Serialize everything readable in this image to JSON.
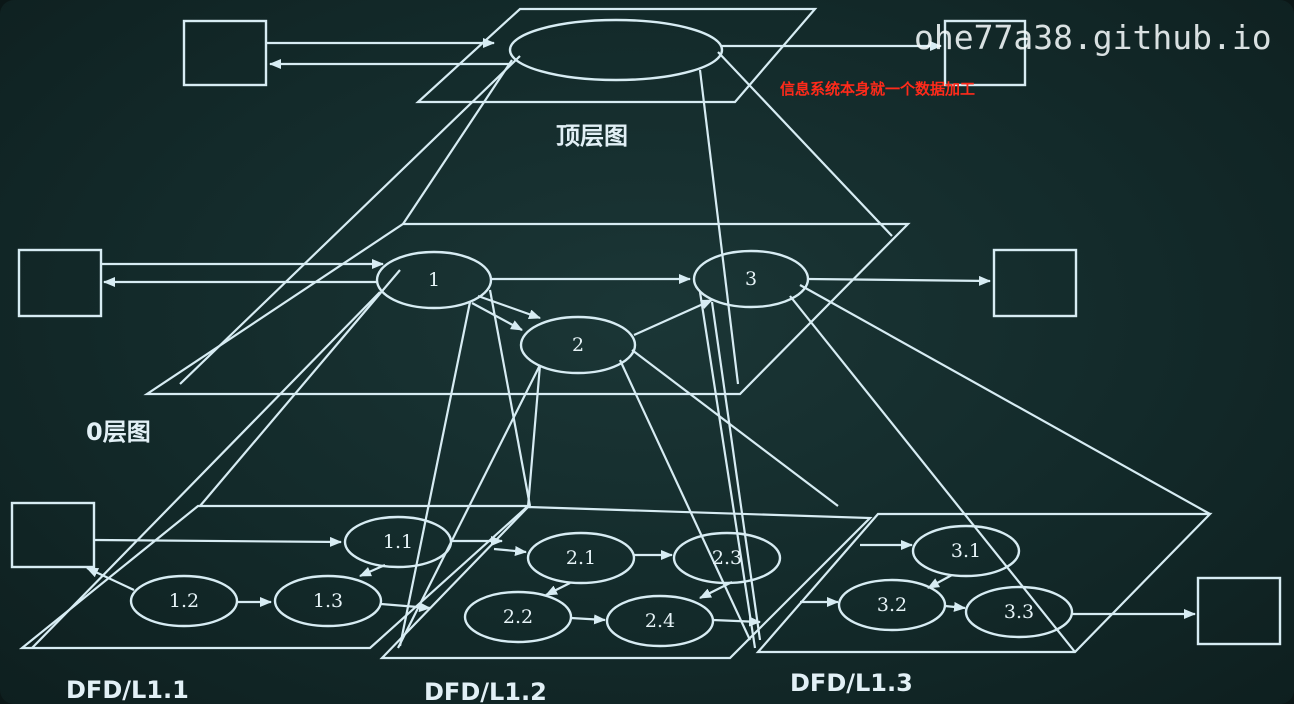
{
  "watermark": "ohe77a38.github.io",
  "annotation": "信息系统本身就一个数据加工",
  "levels": {
    "top": "顶层图",
    "zero": "0层图",
    "l11": "DFD/L1.1",
    "l12": "DFD/L1.2",
    "l13": "DFD/L1.3"
  },
  "nodes": {
    "n1": "1",
    "n2": "2",
    "n3": "3",
    "n11": "1.1",
    "n12": "1.2",
    "n13": "1.3",
    "n21": "2.1",
    "n22": "2.2",
    "n23": "2.3",
    "n24": "2.4",
    "n31": "3.1",
    "n32": "3.2",
    "n33": "3.3"
  },
  "colors": {
    "background": "#132a2a",
    "line": "#d7ecf3",
    "annotation": "#ff2a1a"
  }
}
